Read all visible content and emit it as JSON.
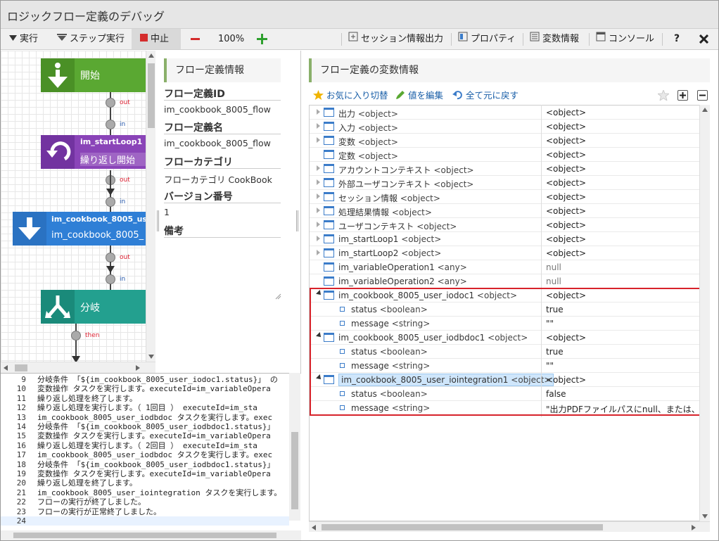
{
  "window": {
    "title": "ロジックフロー定義のデバッグ"
  },
  "toolbar": {
    "run": "実行",
    "step": "ステップ実行",
    "stop": "中止",
    "zoom": "100%",
    "session_output": "セッション情報出力",
    "properties": "プロパティ",
    "variables": "変数情報",
    "console": "コンソール",
    "help": "?"
  },
  "flow": {
    "nodes": [
      {
        "label": "開始",
        "color": "#5aa832",
        "icon": "arrow-down-icon"
      },
      {
        "label": "im_startLoop1",
        "sub": "繰り返し開始",
        "color": "#8a44b8",
        "icon": "loop-icon"
      },
      {
        "label": "im_cookbook_8005_user",
        "sub": "im_cookbook_8005_",
        "color": "#2f7fd6",
        "icon": "arrow-down-icon"
      },
      {
        "label": "分岐",
        "color": "#23a08f",
        "icon": "branch-icon"
      }
    ],
    "port_labels": {
      "out": "out",
      "in": "in",
      "then": "then"
    }
  },
  "info": {
    "header": "フロー定義情報",
    "id_label": "フロー定義ID",
    "id_value": "im_cookbook_8005_flow",
    "name_label": "フロー定義名",
    "name_value": "im_cookbook_8005_flow",
    "category_label": "フローカテゴリ",
    "category_value": "フローカテゴリ CookBook",
    "version_label": "バージョン番号",
    "version_value": "1",
    "note_label": "備考"
  },
  "log": {
    "lines": [
      {
        "n": "9",
        "t": "分岐条件 「${im_cookbook_8005_user_iodoc1.status}」 の"
      },
      {
        "n": "10",
        "t": "変数操作 タスクを実行します。executeId=im_variableOpera"
      },
      {
        "n": "11",
        "t": "繰り返し処理を終了します。"
      },
      {
        "n": "12",
        "t": "繰り返し処理を実行します。（ 1回目 ） executeId=im_sta"
      },
      {
        "n": "13",
        "t": "im_cookbook_8005_user_iodbdoc タスクを実行します。exec"
      },
      {
        "n": "14",
        "t": "分岐条件 「${im_cookbook_8005_user_iodbdoc1.status}」 "
      },
      {
        "n": "15",
        "t": "変数操作 タスクを実行します。executeId=im_variableOpera"
      },
      {
        "n": "16",
        "t": "繰り返し処理を実行します。（ 2回目 ） executeId=im_sta"
      },
      {
        "n": "17",
        "t": "im_cookbook_8005_user_iodbdoc タスクを実行します。exec"
      },
      {
        "n": "18",
        "t": "分岐条件 「${im_cookbook_8005_user_iodbdoc1.status}」 "
      },
      {
        "n": "19",
        "t": "変数操作 タスクを実行します。executeId=im_variableOpera"
      },
      {
        "n": "20",
        "t": "繰り返し処理を終了します。"
      },
      {
        "n": "21",
        "t": "im_cookbook_8005_user_iointegration タスクを実行します。"
      },
      {
        "n": "22",
        "t": "フローの実行が終了しました。"
      },
      {
        "n": "23",
        "t": "フローの実行が正常終了しました。"
      },
      {
        "n": "24",
        "t": ""
      }
    ]
  },
  "vars": {
    "header": "フロー定義の変数情報",
    "favorite": "お気に入り切替",
    "edit": "値を編集",
    "reset": "全て元に戻す",
    "rows": [
      {
        "name": "出力",
        "type": "<object>",
        "value": "<object>",
        "level": 0,
        "state": "c"
      },
      {
        "name": "入力",
        "type": "<object>",
        "value": "<object>",
        "level": 0,
        "state": "c"
      },
      {
        "name": "変数",
        "type": "<object>",
        "value": "<object>",
        "level": 0,
        "state": "c"
      },
      {
        "name": "定数",
        "type": "<object>",
        "value": "<object>",
        "level": 0,
        "state": "n"
      },
      {
        "name": "アカウントコンテキスト",
        "type": "<object>",
        "value": "<object>",
        "level": 0,
        "state": "c"
      },
      {
        "name": "外部ユーザコンテキスト",
        "type": "<object>",
        "value": "<object>",
        "level": 0,
        "state": "c"
      },
      {
        "name": "セッション情報",
        "type": "<object>",
        "value": "<object>",
        "level": 0,
        "state": "c"
      },
      {
        "name": "処理結果情報",
        "type": "<object>",
        "value": "<object>",
        "level": 0,
        "state": "c"
      },
      {
        "name": "ユーザコンテキスト",
        "type": "<object>",
        "value": "<object>",
        "level": 0,
        "state": "c"
      },
      {
        "name": "im_startLoop1",
        "type": "<object>",
        "value": "<object>",
        "level": 0,
        "state": "c"
      },
      {
        "name": "im_startLoop2",
        "type": "<object>",
        "value": "<object>",
        "level": 0,
        "state": "c"
      },
      {
        "name": "im_variableOperation1",
        "type": "<any>",
        "value": "null",
        "level": 0,
        "state": "n"
      },
      {
        "name": "im_variableOperation2",
        "type": "<any>",
        "value": "null",
        "level": 0,
        "state": "n"
      },
      {
        "name": "im_cookbook_8005_user_iodoc1",
        "type": "<object>",
        "value": "<object>",
        "level": 0,
        "state": "e"
      },
      {
        "name": "status",
        "type": "<boolean>",
        "value": "true",
        "level": 1,
        "state": "leaf"
      },
      {
        "name": "message",
        "type": "<string>",
        "value": "\"\"",
        "level": 1,
        "state": "leaf"
      },
      {
        "name": "im_cookbook_8005_user_iodbdoc1",
        "type": "<object>",
        "value": "<object>",
        "level": 0,
        "state": "e"
      },
      {
        "name": "status",
        "type": "<boolean>",
        "value": "true",
        "level": 1,
        "state": "leaf"
      },
      {
        "name": "message",
        "type": "<string>",
        "value": "\"\"",
        "level": 1,
        "state": "leaf"
      },
      {
        "name": "im_cookbook_8005_user_iointegration1",
        "type": "<object>",
        "value": "<object>",
        "level": 0,
        "state": "e",
        "selected": true
      },
      {
        "name": "status",
        "type": "<boolean>",
        "value": "false",
        "level": 1,
        "state": "leaf"
      },
      {
        "name": "message",
        "type": "<string>",
        "value": "\"出力PDFファイルパスにnull、または、空",
        "level": 1,
        "state": "leaf"
      }
    ]
  },
  "colors": {
    "accent": "#8ab06a",
    "highlight": "#d7232b",
    "link": "#1a5fa8"
  }
}
